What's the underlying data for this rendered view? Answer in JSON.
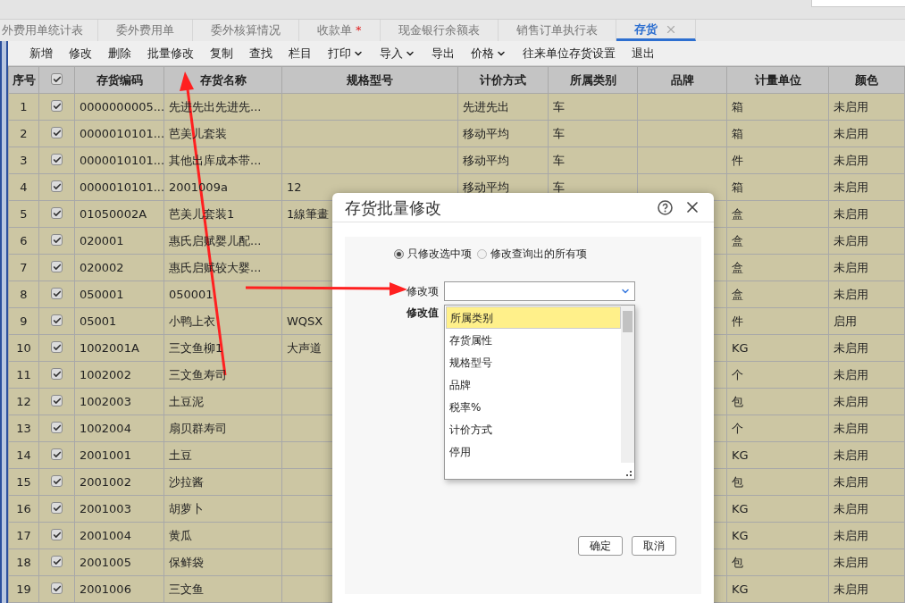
{
  "tabs": [
    {
      "label": "外费用单统计表",
      "selected": false
    },
    {
      "label": "委外费用单",
      "selected": false
    },
    {
      "label": "委外核算情况",
      "selected": false
    },
    {
      "label": "收款单",
      "badge": "*",
      "selected": false
    },
    {
      "label": "现金银行余额表",
      "selected": false
    },
    {
      "label": "销售订单执行表",
      "selected": false
    },
    {
      "label": "存货",
      "selected": true,
      "closable": true
    }
  ],
  "toolbar": [
    {
      "label": "新增",
      "dropdown": false
    },
    {
      "label": "修改",
      "dropdown": false
    },
    {
      "label": "删除",
      "dropdown": false
    },
    {
      "label": "批量修改",
      "dropdown": false
    },
    {
      "label": "复制",
      "dropdown": false
    },
    {
      "label": "查找",
      "dropdown": false
    },
    {
      "label": "栏目",
      "dropdown": false
    },
    {
      "label": "打印",
      "dropdown": true
    },
    {
      "label": "导入",
      "dropdown": true
    },
    {
      "label": "导出",
      "dropdown": false
    },
    {
      "label": "价格",
      "dropdown": true
    },
    {
      "label": "往来单位存货设置",
      "dropdown": false
    },
    {
      "label": "退出",
      "dropdown": false
    }
  ],
  "table": {
    "columns": [
      "序号",
      "存货编码",
      "存货名称",
      "规格型号",
      "计价方式",
      "所属类别",
      "品牌",
      "计量单位",
      "颜色"
    ],
    "all_checked": true,
    "rows": [
      {
        "no": "1",
        "checked": true,
        "code": "0000000005...",
        "name": "先进先出先进先...",
        "pricing": "先进先出",
        "category": "车",
        "unit": "箱",
        "enabled_state": "未启用"
      },
      {
        "no": "2",
        "checked": true,
        "code": "0000010101...",
        "name": "芭美儿套装",
        "pricing": "移动平均",
        "category": "车",
        "unit": "箱",
        "enabled_state": "未启用"
      },
      {
        "no": "3",
        "checked": true,
        "code": "0000010101...",
        "name": "其他出库成本带...",
        "pricing": "移动平均",
        "category": "车",
        "unit": "件",
        "enabled_state": "未启用"
      },
      {
        "no": "4",
        "checked": true,
        "code": "0000010101...",
        "name": "2001009a",
        "spec": "12",
        "pricing": "移动平均",
        "category": "车",
        "unit": "箱",
        "enabled_state": "未启用"
      },
      {
        "no": "5",
        "checked": true,
        "code": "01050002A",
        "name": "芭美儿套装1",
        "spec": "1線筆畫",
        "unit": "盒",
        "enabled_state": "未启用"
      },
      {
        "no": "6",
        "checked": true,
        "code": "020001",
        "name": "惠氏启赋婴儿配...",
        "unit": "盒",
        "enabled_state": "未启用"
      },
      {
        "no": "7",
        "checked": true,
        "code": "020002",
        "name": "惠氏启赋较大婴...",
        "unit": "盒",
        "enabled_state": "未启用"
      },
      {
        "no": "8",
        "checked": true,
        "code": "050001",
        "name": "050001",
        "unit": "盒",
        "enabled_state": "未启用"
      },
      {
        "no": "9",
        "checked": true,
        "code": "05001",
        "name": "小鸭上衣",
        "spec": "WQSX",
        "unit": "件",
        "enabled_state": "启用"
      },
      {
        "no": "10",
        "checked": true,
        "code": "1002001A",
        "name": "三文鱼柳1",
        "spec": "大声道",
        "unit": "KG",
        "enabled_state": "未启用"
      },
      {
        "no": "11",
        "checked": true,
        "code": "1002002",
        "name": "三文鱼寿司",
        "unit": "个",
        "enabled_state": "未启用"
      },
      {
        "no": "12",
        "checked": true,
        "code": "1002003",
        "name": "土豆泥",
        "unit": "包",
        "enabled_state": "未启用"
      },
      {
        "no": "13",
        "checked": true,
        "code": "1002004",
        "name": "扇贝群寿司",
        "unit": "个",
        "enabled_state": "未启用"
      },
      {
        "no": "14",
        "checked": true,
        "code": "2001001",
        "name": "土豆",
        "unit": "KG",
        "enabled_state": "未启用"
      },
      {
        "no": "15",
        "checked": true,
        "code": "2001002",
        "name": "沙拉酱",
        "unit": "包",
        "enabled_state": "未启用"
      },
      {
        "no": "16",
        "checked": true,
        "code": "2001003",
        "name": "胡萝卜",
        "unit": "KG",
        "enabled_state": "未启用"
      },
      {
        "no": "17",
        "checked": true,
        "code": "2001004",
        "name": "黄瓜",
        "unit": "KG",
        "enabled_state": "未启用"
      },
      {
        "no": "18",
        "checked": true,
        "code": "2001005",
        "name": "保鲜袋",
        "unit": "包",
        "enabled_state": "未启用"
      },
      {
        "no": "19",
        "checked": true,
        "code": "2001006",
        "name": "三文鱼",
        "unit": "KG",
        "enabled_state": "未启用"
      }
    ]
  },
  "dialog": {
    "title": "存货批量修改",
    "scope": [
      {
        "label": "只修改选中项",
        "selected": true
      },
      {
        "label": "修改查询出的所有项",
        "selected": false
      }
    ],
    "field_label": "修改项",
    "value_label": "修改值",
    "options": [
      {
        "label": "所属类别",
        "selected": true
      },
      {
        "label": "存货属性",
        "selected": false
      },
      {
        "label": "规格型号",
        "selected": false
      },
      {
        "label": "品牌",
        "selected": false
      },
      {
        "label": "税率%",
        "selected": false
      },
      {
        "label": "计价方式",
        "selected": false
      },
      {
        "label": "停用",
        "selected": false
      }
    ],
    "buttons": [
      "确定",
      "取消"
    ]
  }
}
